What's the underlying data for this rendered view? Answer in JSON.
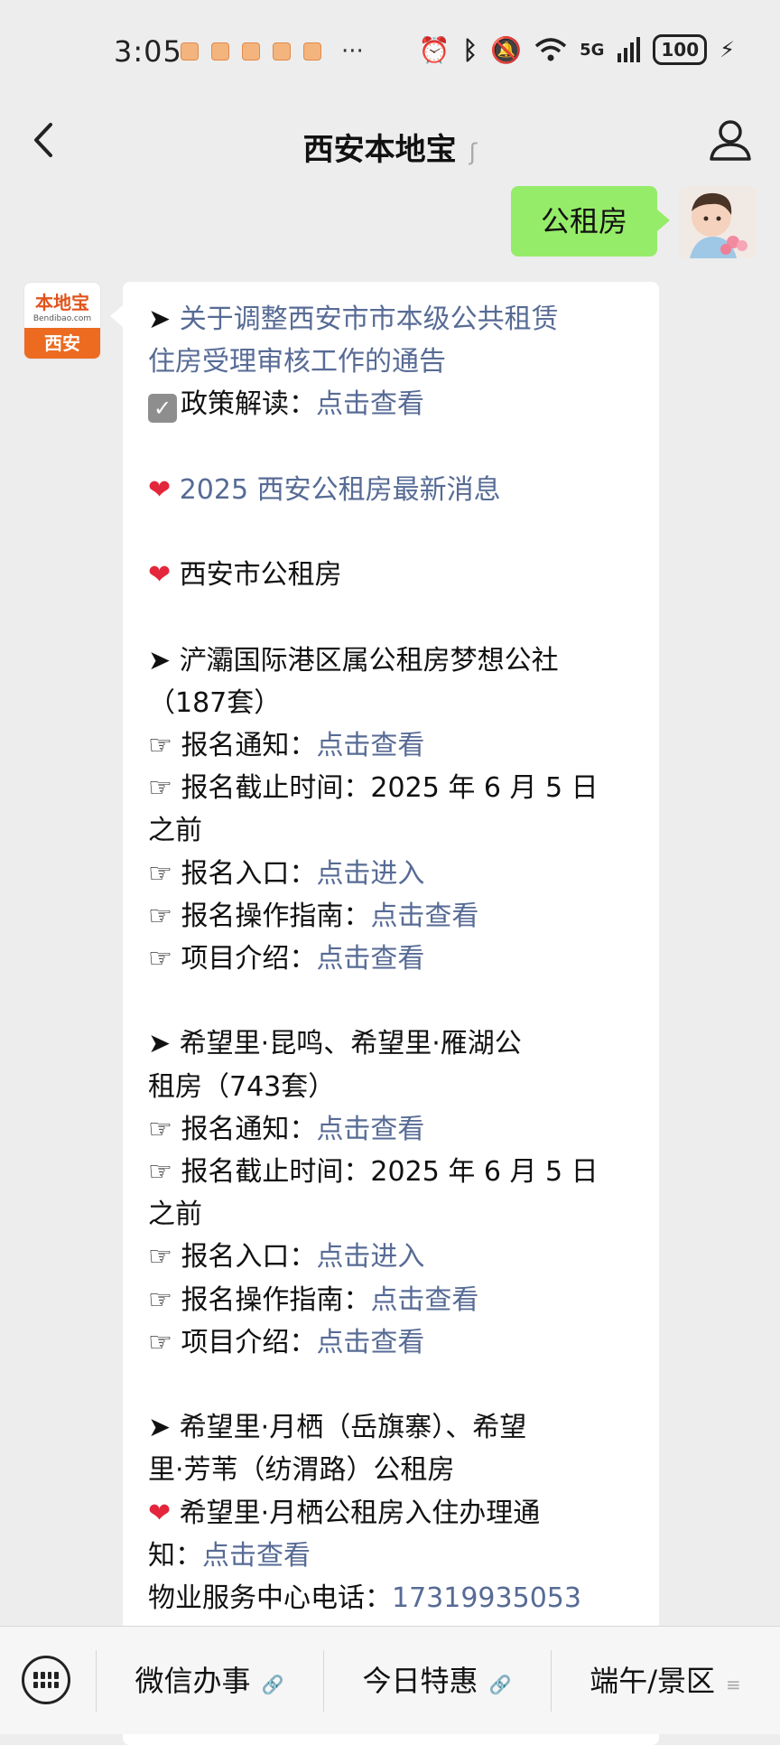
{
  "status": {
    "time": "3:05",
    "more": "···",
    "battery": "100",
    "network": "5G"
  },
  "nav": {
    "title": "西安本地宝"
  },
  "chat": {
    "sent_text": "公租房",
    "bot_avatar": {
      "logo_text": "本地宝",
      "logo_small": "Bendibao.com",
      "city": "西安"
    },
    "received_lines": [
      {
        "prefix": "➤ ",
        "text": "关于调整西安市市本级公共租赁",
        "link": true
      },
      {
        "prefix": "",
        "text": "住房受理审核工作的通告",
        "link": true
      },
      {
        "prefix": "check",
        "text": "政策解读：",
        "link_text": "点击查看"
      },
      {
        "blank": true
      },
      {
        "prefix": "❤ ",
        "text": "2025 西安公租房最新消息",
        "link": true
      },
      {
        "blank": true
      },
      {
        "prefix": "❤ ",
        "text": "西安市公租房"
      },
      {
        "blank": true
      },
      {
        "prefix": "➤ ",
        "text": "浐灞国际港区属公租房梦想公社"
      },
      {
        "prefix": "",
        "text": "（187套）"
      },
      {
        "prefix": "☞ ",
        "text": "报名通知：",
        "link_text": "点击查看"
      },
      {
        "prefix": "☞ ",
        "text": "报名截止时间：2025 年 6 月 5 日"
      },
      {
        "prefix": "",
        "text": "之前"
      },
      {
        "prefix": "☞ ",
        "text": "报名入口：",
        "link_text": "点击进入"
      },
      {
        "prefix": "☞ ",
        "text": "报名操作指南：",
        "link_text": "点击查看"
      },
      {
        "prefix": "☞ ",
        "text": "项目介绍：",
        "link_text": "点击查看"
      },
      {
        "blank": true
      },
      {
        "prefix": "➤ ",
        "text": "希望里·昆鸣、希望里·雁湖公"
      },
      {
        "prefix": "",
        "text": "租房（743套）"
      },
      {
        "prefix": "☞ ",
        "text": "报名通知：",
        "link_text": "点击查看"
      },
      {
        "prefix": "☞ ",
        "text": "报名截止时间：2025 年 6 月 5 日"
      },
      {
        "prefix": "",
        "text": "之前"
      },
      {
        "prefix": "☞ ",
        "text": "报名入口：",
        "link_text": "点击进入"
      },
      {
        "prefix": "☞ ",
        "text": "报名操作指南：",
        "link_text": "点击查看"
      },
      {
        "prefix": "☞ ",
        "text": "项目介绍：",
        "link_text": "点击查看"
      },
      {
        "blank": true
      },
      {
        "prefix": "➤ ",
        "text": "希望里·月栖（岳旗寨）、希望"
      },
      {
        "prefix": "",
        "text": "里·芳苇（纺渭路）公租房"
      },
      {
        "prefix": "❤ ",
        "text": "希望里·月栖公租房入住办理通"
      },
      {
        "prefix": "",
        "text": "知：",
        "link_text": "点击查看"
      },
      {
        "prefix": "",
        "text": "物业服务中心电话：",
        "link_text": "17319935053"
      }
    ]
  },
  "bottom_menu": {
    "items": [
      {
        "label": "微信办事",
        "icon": "link-icon"
      },
      {
        "label": "今日特惠",
        "icon": "link-icon"
      },
      {
        "label": "端午/景区",
        "icon": "submenu-icon"
      }
    ]
  },
  "colors": {
    "background": "#ededed",
    "sent_bubble": "#95ec69",
    "link": "#576b95",
    "heart": "#e4263c",
    "brand_orange": "#ec6b21"
  }
}
